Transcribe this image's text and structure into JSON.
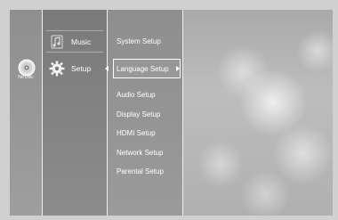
{
  "status": {
    "disc": "No Disc",
    "disc_icon": "disc-icon"
  },
  "main_menu": {
    "items": [
      {
        "label": "Music",
        "icon": "music-note-icon"
      },
      {
        "label": "Setup",
        "icon": "gear-icon",
        "selected": true
      }
    ]
  },
  "setup_menu": {
    "items": [
      {
        "label": "System Setup"
      },
      {
        "label": "Language Setup",
        "selected": true
      },
      {
        "label": "Audio Setup"
      },
      {
        "label": "Display Setup"
      },
      {
        "label": "HDMI Setup"
      },
      {
        "label": "Network Setup"
      },
      {
        "label": "Parental Setup"
      }
    ]
  },
  "colors": {
    "frame": "#d0d0d0",
    "text": "#ffffff",
    "panel": "#8a8a8a"
  }
}
